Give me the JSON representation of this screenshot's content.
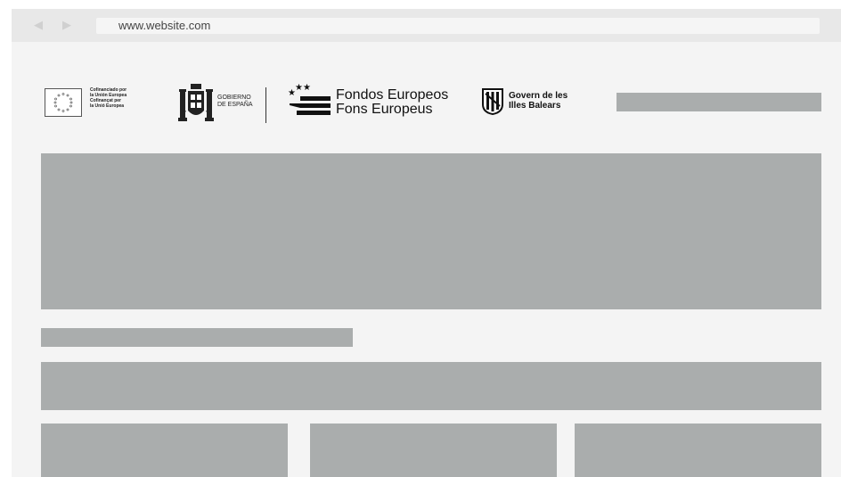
{
  "browser": {
    "url": "www.website.com",
    "back_icon": "chevron-left-icon",
    "forward_icon": "chevron-right-icon"
  },
  "logos": {
    "eu": {
      "text": "Cofinanciado por\nla Unión Europea\nCofinançat per\nla Unió Europea"
    },
    "gobierno": {
      "text": "GOBIERNO\nDE ESPAÑA"
    },
    "fondos": {
      "text": "Fondos Europeos\nFons Europeus"
    },
    "govern": {
      "text": "Govern de les\nIlles Balears"
    }
  },
  "colors": {
    "placeholder": "#aaadad",
    "window_bg": "#f4f4f4",
    "toolbar_bg": "#e8e8e8"
  }
}
